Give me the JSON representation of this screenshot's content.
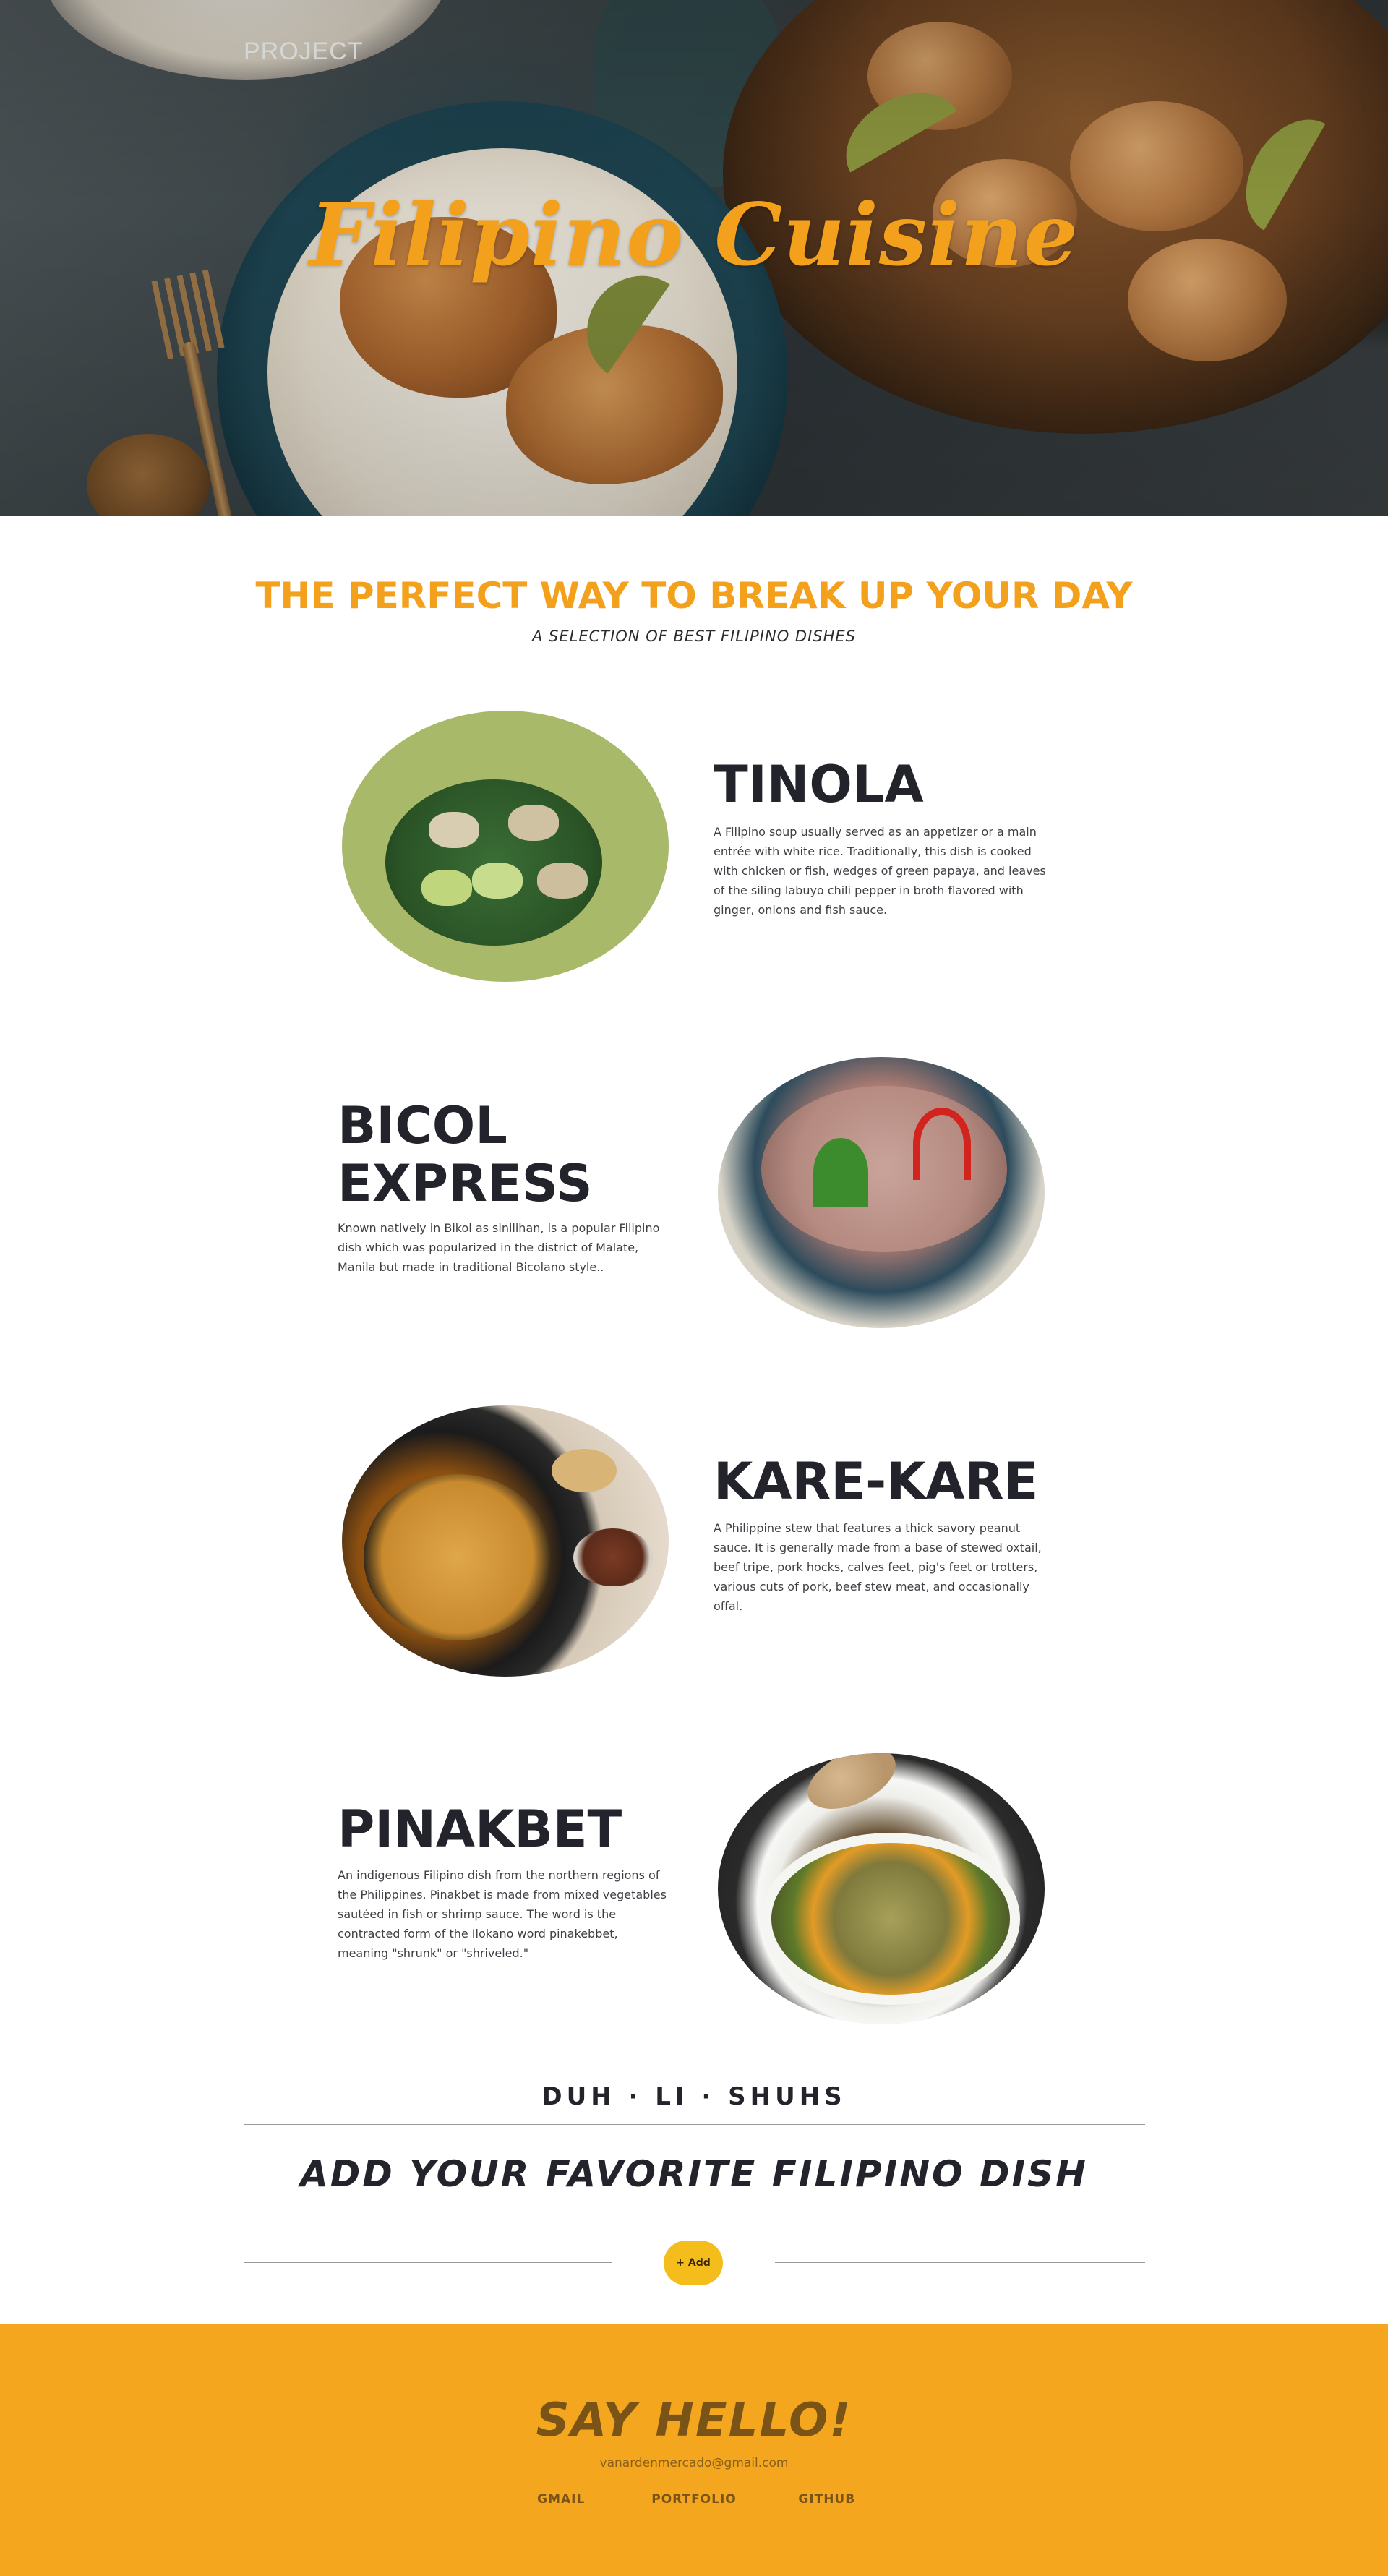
{
  "nav": {
    "brand": "PROJECT"
  },
  "hero": {
    "title": "Filipino Cuisine"
  },
  "intro": {
    "title": "THE PERFECT WAY TO BREAK UP YOUR DAY",
    "subtitle": "A SELECTION OF BEST FILIPINO DISHES"
  },
  "dishes": [
    {
      "name": "TINOLA",
      "description": "A Filipino soup usually served as an appetizer or a main entrée with white rice. Traditionally, this dish is cooked with chicken or fish, wedges of green papaya, and leaves of the siling labuyo chili pepper in broth flavored with ginger, onions and fish sauce."
    },
    {
      "name": "BICOL EXPRESS",
      "description": "Known natively in Bikol as sinilihan, is a popular Filipino dish which was popularized in the district of Malate, Manila but made in traditional Bicolano style.."
    },
    {
      "name": "KARE-KARE",
      "description": "A Philippine stew that features a thick savory peanut sauce. It is generally made from a base of stewed oxtail, beef tripe, pork hocks, calves feet, pig's feet or trotters, various cuts of pork, beef stew meat, and occasionally offal."
    },
    {
      "name": "PINAKBET",
      "description": "An indigenous Filipino dish from the northern regions of the Philippines. Pinakbet is made from mixed vegetables sautéed in fish or shrimp sauce. The word is the contracted form of the Ilokano word pinakebbet, meaning \"shrunk\" or \"shriveled.\""
    }
  ],
  "add_section": {
    "heading": "DUH · LI · SHUHS",
    "title": "ADD YOUR FAVORITE FILIPINO DISH",
    "button_label": "+ Add"
  },
  "footer": {
    "heading": "SAY HELLO!",
    "email": "vanardenmercado@gmail.com",
    "links": [
      "GMAIL",
      "PORTFOLIO",
      "GITHUB"
    ]
  },
  "colors": {
    "accent": "#f3a11d",
    "footer_bg": "#f4a61f",
    "button": "#f5bd1c"
  }
}
